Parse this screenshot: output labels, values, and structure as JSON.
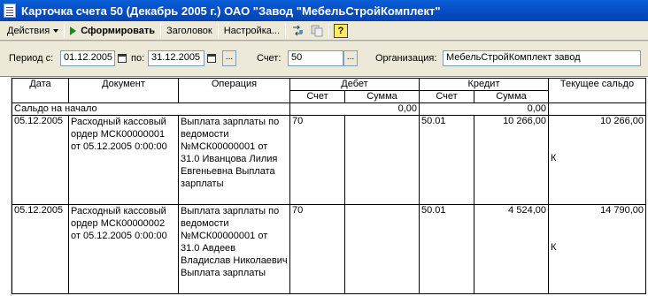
{
  "window": {
    "title": "Карточка счета 50 (Декабрь 2005 г.) ОАО \"Завод \"МебельСтройКомплект\""
  },
  "toolbar": {
    "actions_label": "Действия",
    "generate_label": "Сформировать",
    "header_label": "Заголовок",
    "settings_label": "Настройка...",
    "help_label": "?"
  },
  "filters": {
    "period_label": "Период с:",
    "date_from": "01.12.2005",
    "to_label": "по:",
    "date_to": "31.12.2005",
    "dots": "...",
    "account_label": "Счет:",
    "account_value": "50",
    "org_label": "Организация:",
    "org_value": "МебельСтройКомплект завод"
  },
  "table": {
    "headers": {
      "date": "Дата",
      "document": "Документ",
      "operation": "Операция",
      "debit": "Дебет",
      "credit": "Кредит",
      "balance": "Текущее сальдо",
      "account": "Счет",
      "sum": "Сумма"
    },
    "opening": {
      "label": "Сальдо на начало",
      "debit_sum": "0,00",
      "credit_sum": "0,00"
    },
    "rows": [
      {
        "date": "05.12.2005",
        "document": "Расходный кассовый ордер МСК00000001 от 05.12.2005 0:00:00",
        "operation": "Выплата зарплаты по ведомости №МСК00000001 от 31.0 Иванцова Лилия Евгеньевна Выплата зарплаты",
        "debit_account": "70",
        "debit_sum": "",
        "credit_account": "50.01",
        "credit_sum": "10 266,00",
        "balance": "10 266,00",
        "balance_type": "К"
      },
      {
        "date": "05.12.2005",
        "document": "Расходный кассовый ордер МСК00000002 от 05.12.2005 0:00:00",
        "operation": "Выплата зарплаты по ведомости №МСК00000001 от 31.0 Авдеев Владислав Николаевич Выплата зарплаты",
        "debit_account": "70",
        "debit_sum": "",
        "credit_account": "50.01",
        "credit_sum": "4 524,00",
        "balance": "14 790,00",
        "balance_type": "К"
      }
    ]
  }
}
